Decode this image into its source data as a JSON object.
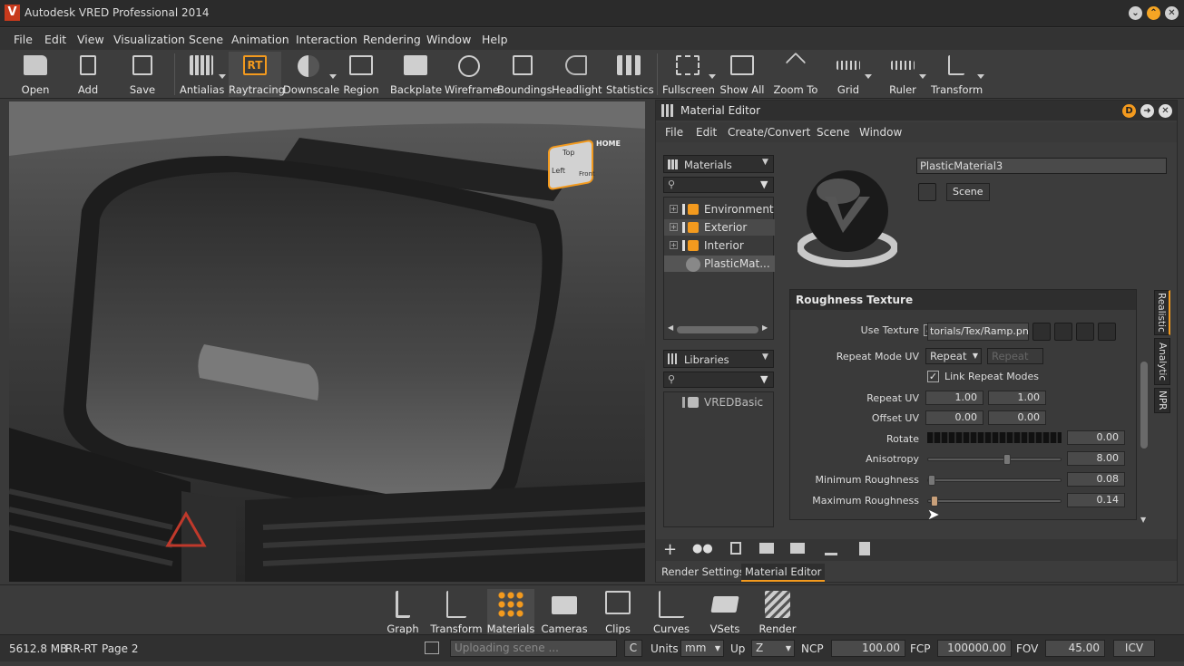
{
  "app": {
    "title": "Autodesk VRED Professional 2014",
    "logo_text": "V"
  },
  "menu": [
    "File",
    "Edit",
    "View",
    "Visualization",
    "Scene",
    "Animation",
    "Interaction",
    "Rendering",
    "Window",
    "Help"
  ],
  "toolbar": [
    {
      "label": "Open",
      "icon": "folder-open-icon"
    },
    {
      "label": "Add",
      "icon": "add-file-icon"
    },
    {
      "label": "Save",
      "icon": "save-icon"
    },
    {
      "label": "Antialias",
      "icon": "antialias-icon"
    },
    {
      "label": "Raytracing",
      "icon": "raytracing-icon",
      "badge": "RT"
    },
    {
      "label": "Downscale",
      "icon": "downscale-icon"
    },
    {
      "label": "Region",
      "icon": "region-icon"
    },
    {
      "label": "Backplate",
      "icon": "backplate-icon"
    },
    {
      "label": "Wireframe",
      "icon": "wireframe-icon"
    },
    {
      "label": "Boundings",
      "icon": "boundings-icon"
    },
    {
      "label": "Headlight",
      "icon": "headlight-icon"
    },
    {
      "label": "Statistics",
      "icon": "statistics-icon"
    },
    {
      "label": "Fullscreen",
      "icon": "fullscreen-icon"
    },
    {
      "label": "Show All",
      "icon": "show-all-icon"
    },
    {
      "label": "Zoom To",
      "icon": "zoom-to-icon"
    },
    {
      "label": "Grid",
      "icon": "grid-icon"
    },
    {
      "label": "Ruler",
      "icon": "ruler-icon"
    },
    {
      "label": "Transform",
      "icon": "transform-icon"
    }
  ],
  "viewcube": {
    "top": "Top",
    "left": "Left",
    "front": "Front",
    "home": "HOME"
  },
  "material_editor": {
    "title": "Material Editor",
    "menu": [
      "File",
      "Edit",
      "Create/Convert",
      "Scene",
      "Window"
    ],
    "materials_combo": "Materials",
    "tree": [
      {
        "label": "Environment"
      },
      {
        "label": "Exterior"
      },
      {
        "label": "Interior"
      },
      {
        "label": "PlasticMat..."
      }
    ],
    "libraries_combo": "Libraries",
    "library_tree": [
      {
        "label": "VREDBasic"
      }
    ],
    "material_name": "PlasticMaterial3",
    "scene_button": "Scene",
    "section_title": "Roughness Texture",
    "use_texture_label": "Use Texture",
    "texture_path": "torials/Tex/Ramp.png",
    "repeat_mode_label": "Repeat Mode UV",
    "repeat_mode_value": "Repeat",
    "repeat_mode_value2": "Repeat",
    "link_repeat_label": "Link Repeat Modes",
    "repeat_uv_label": "Repeat UV",
    "repeat_u": "1.00",
    "repeat_v": "1.00",
    "offset_uv_label": "Offset UV",
    "offset_u": "0.00",
    "offset_v": "0.00",
    "rotate_label": "Rotate",
    "rotate_value": "0.00",
    "anisotropy_label": "Anisotropy",
    "anisotropy_value": "8.00",
    "anisotropy_fraction": 0.6,
    "min_rough_label": "Minimum Roughness",
    "min_rough_value": "0.08",
    "min_rough_fraction": 0.0,
    "max_rough_label": "Maximum Roughness",
    "max_rough_value": "0.14",
    "max_rough_fraction": 0.02,
    "side_tabs": [
      "Realistic",
      "Analytic",
      "NPR"
    ],
    "bottom_tabs": [
      "Render Settings",
      "Material Editor"
    ]
  },
  "bottombar": [
    {
      "label": "Graph",
      "icon": "graph-icon"
    },
    {
      "label": "Transform",
      "icon": "transform-icon"
    },
    {
      "label": "Materials",
      "icon": "materials-icon"
    },
    {
      "label": "Cameras",
      "icon": "cameras-icon"
    },
    {
      "label": "Clips",
      "icon": "clips-icon"
    },
    {
      "label": "Curves",
      "icon": "curves-icon"
    },
    {
      "label": "VSets",
      "icon": "vsets-icon"
    },
    {
      "label": "Render",
      "icon": "render-icon"
    }
  ],
  "status": {
    "memory": "5612.8 MB",
    "mode": "RR-RT",
    "page": "Page 2",
    "console_placeholder": "Uploading scene ...",
    "c_button": "C",
    "units_label": "Units",
    "units_value": "mm",
    "up_label": "Up",
    "up_value": "Z",
    "ncp_label": "NCP",
    "ncp_value": "100.00",
    "fcp_label": "FCP",
    "fcp_value": "100000.00",
    "fov_label": "FOV",
    "fov_value": "45.00",
    "icv_button": "ICV"
  },
  "colors": {
    "accent": "#f39a1e",
    "background": "#3a3a3a",
    "dark": "#2b2b2b"
  }
}
